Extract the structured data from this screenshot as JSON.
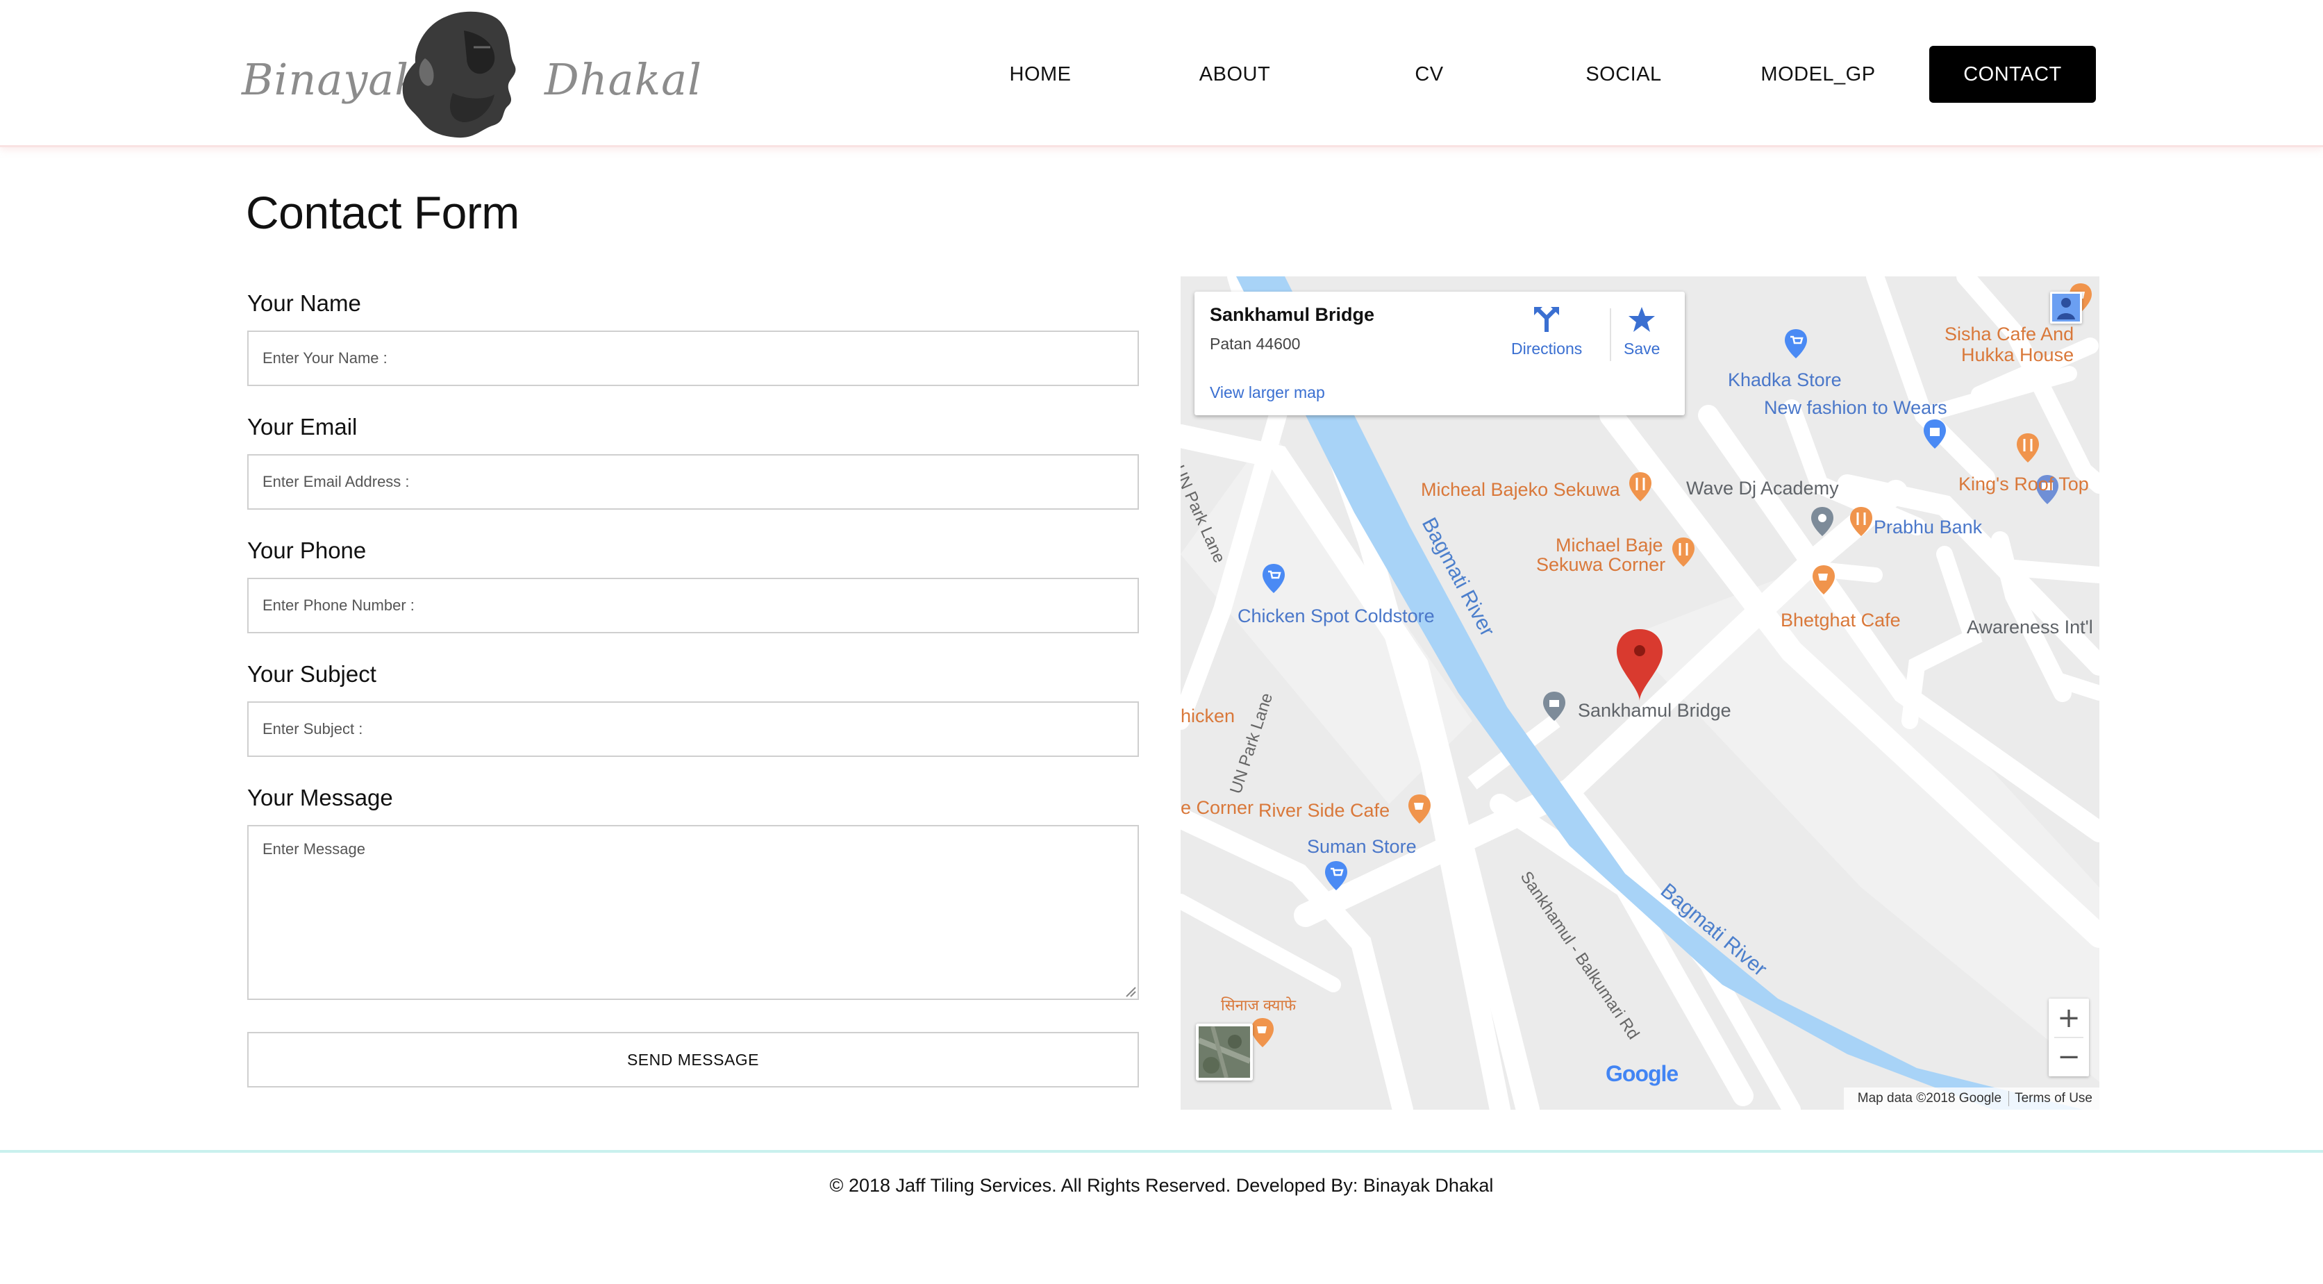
{
  "brand": {
    "first_name": "Binayak",
    "last_name": "Dhakal",
    "portrait_icon": "portrait-silhouette"
  },
  "nav": {
    "items": [
      {
        "label": "HOME"
      },
      {
        "label": "ABOUT"
      },
      {
        "label": "CV"
      },
      {
        "label": "SOCIAL"
      },
      {
        "label": "MODEL_GP"
      },
      {
        "label": "CONTACT",
        "active": true
      }
    ],
    "active_color": "#000000"
  },
  "form": {
    "title": "Contact Form",
    "name": {
      "label": "Your Name",
      "placeholder": "Enter Your Name :",
      "value": ""
    },
    "email": {
      "label": "Your Email",
      "placeholder": "Enter Email Address :",
      "value": ""
    },
    "phone": {
      "label": "Your Phone",
      "placeholder": "Enter Phone Number :",
      "value": ""
    },
    "subject": {
      "label": "Your Subject",
      "placeholder": "Enter Subject :",
      "value": ""
    },
    "message": {
      "label": "Your Message",
      "placeholder": "Enter Message",
      "value": ""
    },
    "submit_label": "SEND MESSAGE"
  },
  "map": {
    "card": {
      "title": "Sankhamul Bridge",
      "address": "Patan 44600",
      "directions_label": "Directions",
      "save_label": "Save",
      "larger_map_link": "View larger map"
    },
    "labels": {
      "sisha_1": "Sisha Cafe And",
      "sisha_2": "Hukka House",
      "khadka": "Khadka Store",
      "new_fashion": "New fashion to Wears",
      "kings_roof": "King's Roof Top",
      "micheal_bajeko": "Micheal Bajeko Sekuwa",
      "wave_dj": "Wave Dj Academy",
      "prabhu": "Prabhu Bank",
      "michael_baje_1": "Michael Baje",
      "michael_baje_2": "Sekuwa Corner",
      "bhetghat": "Bhetghat Cafe",
      "awareness": "Awareness Int'l",
      "chicken_spot": "Chicken Spot Coldstore",
      "sankhamul_bridge": "Sankhamul Bridge",
      "hicken": "hicken",
      "corner": "e Corner",
      "river_side": "River Side Cafe",
      "suman": "Suman Store",
      "sinaj": "सिनाज क्याफे",
      "un_park_lane_1": "UN Park Lane",
      "un_park_lane_2": "UN Park Lane",
      "bagmati_1": "Bagmati River",
      "bagmati_2": "Bagmati River",
      "sankhamul_rd": "Sankhamul - Balkumari Rd"
    },
    "zoom_in": "+",
    "zoom_out": "−",
    "logo": "Google",
    "attribution": "Map data ©2018 Google",
    "terms": "Terms of Use",
    "colors": {
      "river": "#a8d3f7",
      "road": "#ffffff",
      "land": "#ebebeb",
      "marker": "#d93a2f",
      "poi_orange": "#f0944c",
      "poi_blue": "#4a8af4"
    }
  },
  "footer": {
    "text": "© 2018 Jaff Tiling Services. All Rights Reserved. Developed By: Binayak Dhakal"
  }
}
